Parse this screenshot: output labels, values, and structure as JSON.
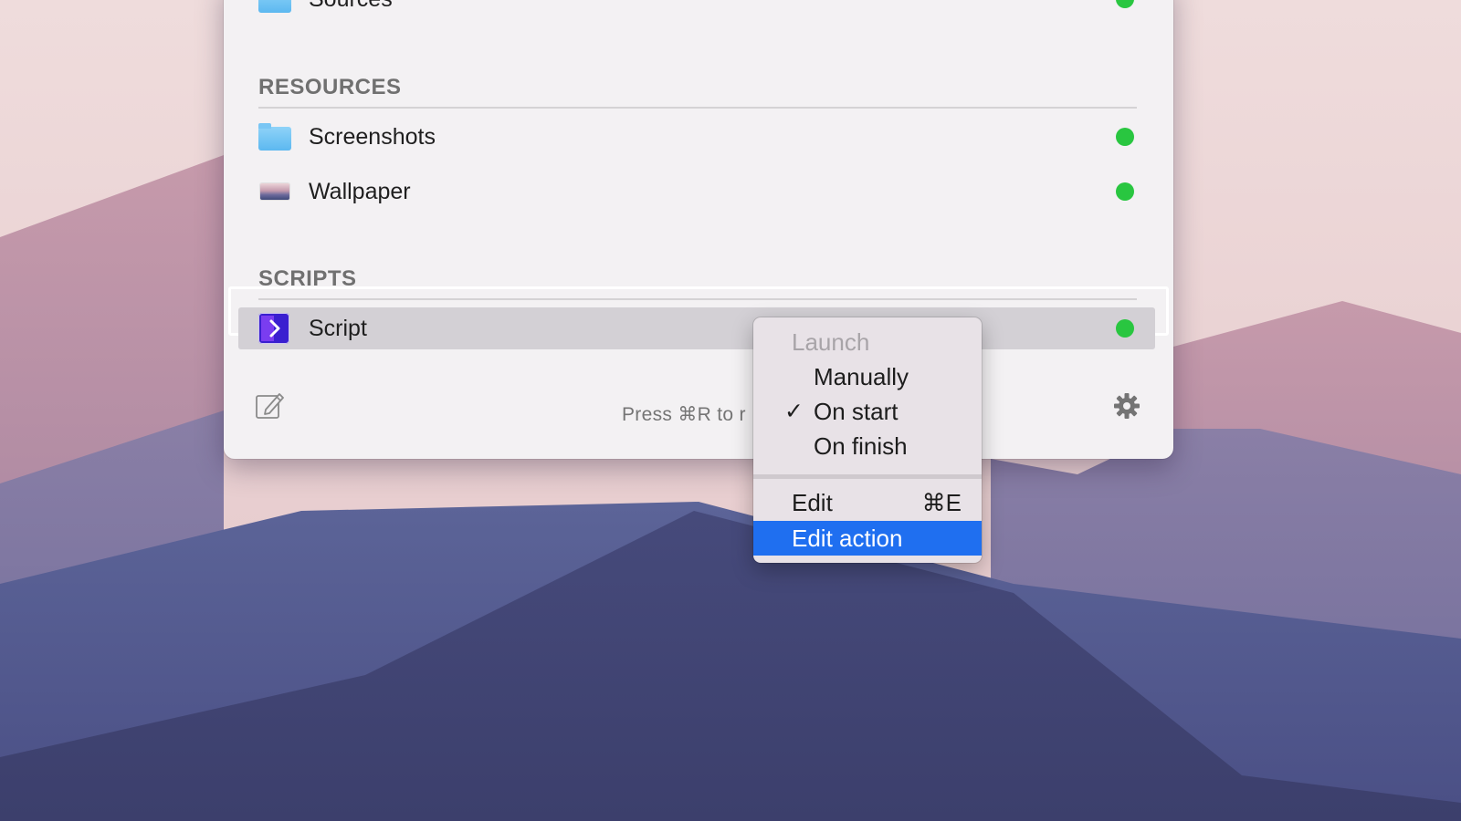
{
  "colors": {
    "status_green": "#29c640",
    "menu_highlight": "#1f6ff0",
    "script_icon": "#3a1fd0",
    "folder_blue": "#6cc0f3"
  },
  "sections": {
    "top_item": {
      "label": "Sources",
      "icon": "folder-icon"
    },
    "resources": {
      "title": "RESOURCES",
      "items": [
        {
          "label": "Screenshots",
          "icon": "folder-icon"
        },
        {
          "label": "Wallpaper",
          "icon": "image-icon"
        }
      ]
    },
    "scripts": {
      "title": "SCRIPTS",
      "items": [
        {
          "label": "Script",
          "icon": "script-icon"
        }
      ]
    }
  },
  "footer": {
    "hint": "Press ⌘R to r",
    "edit_icon": "edit-icon",
    "settings_icon": "gear-icon"
  },
  "context_menu": {
    "launch_header": "Launch",
    "manually": "Manually",
    "on_start": "On start",
    "on_start_check": "✓",
    "on_finish": "On finish",
    "edit": "Edit",
    "edit_shortcut": "⌘E",
    "edit_action": "Edit action"
  }
}
